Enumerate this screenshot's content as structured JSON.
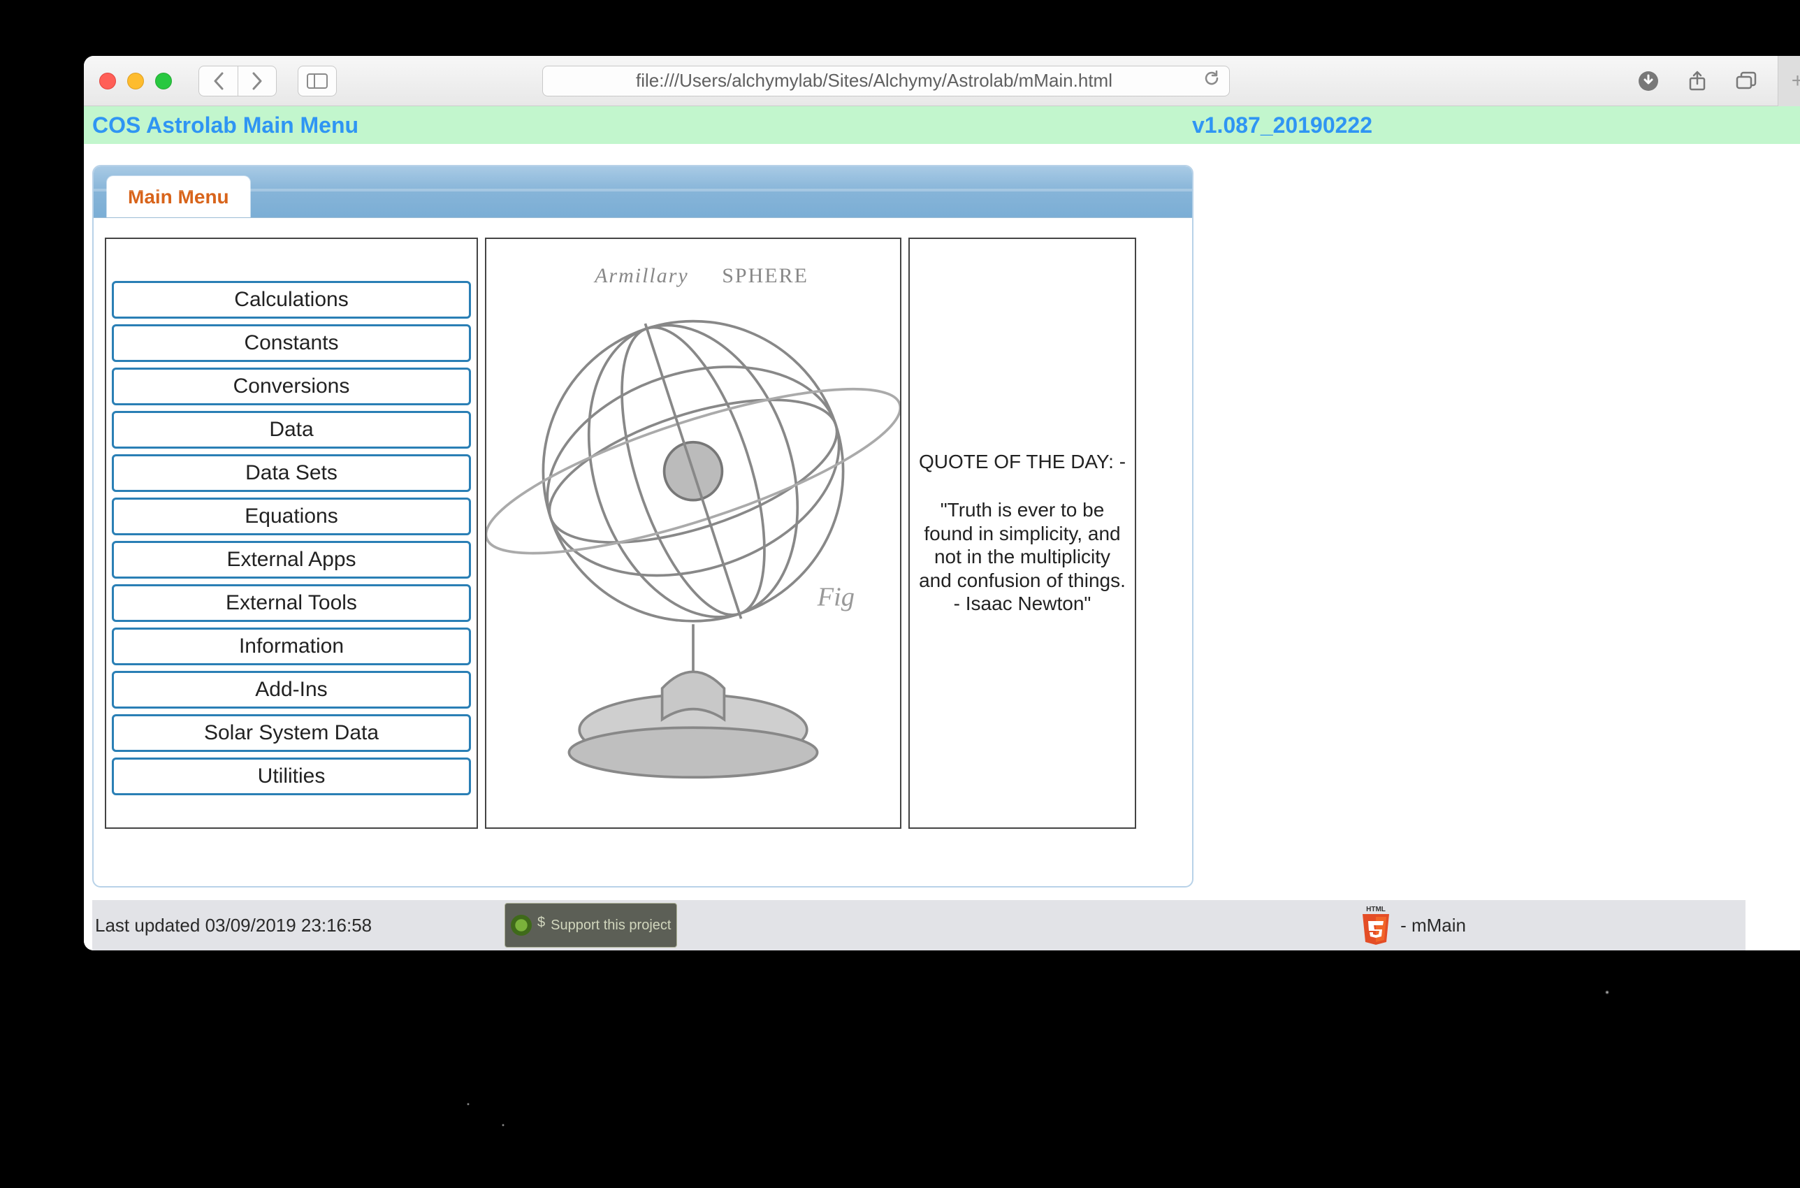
{
  "browser": {
    "url": "file:///Users/alchymylab/Sites/Alchymy/Astrolab/mMain.html"
  },
  "header": {
    "title": "COS Astrolab Main Menu",
    "version": "v1.087_20190222"
  },
  "panel": {
    "tab_label": "Main Menu",
    "menu_items": [
      "Calculations",
      "Constants",
      "Conversions",
      "Data",
      "Data Sets",
      "Equations",
      "External Apps",
      "External Tools",
      "Information",
      "Add-Ins",
      "Solar System Data",
      "Utilities"
    ],
    "image_caption_left": "Armillary",
    "image_caption_right": "SPHERE",
    "image_fig": "Fig",
    "quote_title": "QUOTE OF THE DAY: -",
    "quote_body": "\"Truth is ever to be found in simplicity, and not in the multiplicity and confusion of things. - Isaac Newton\""
  },
  "footer": {
    "updated": "Last updated 03/09/2019 23:16:58",
    "support_label": "Support this project",
    "html5_label": "HTML",
    "page_name": "- mMain"
  }
}
